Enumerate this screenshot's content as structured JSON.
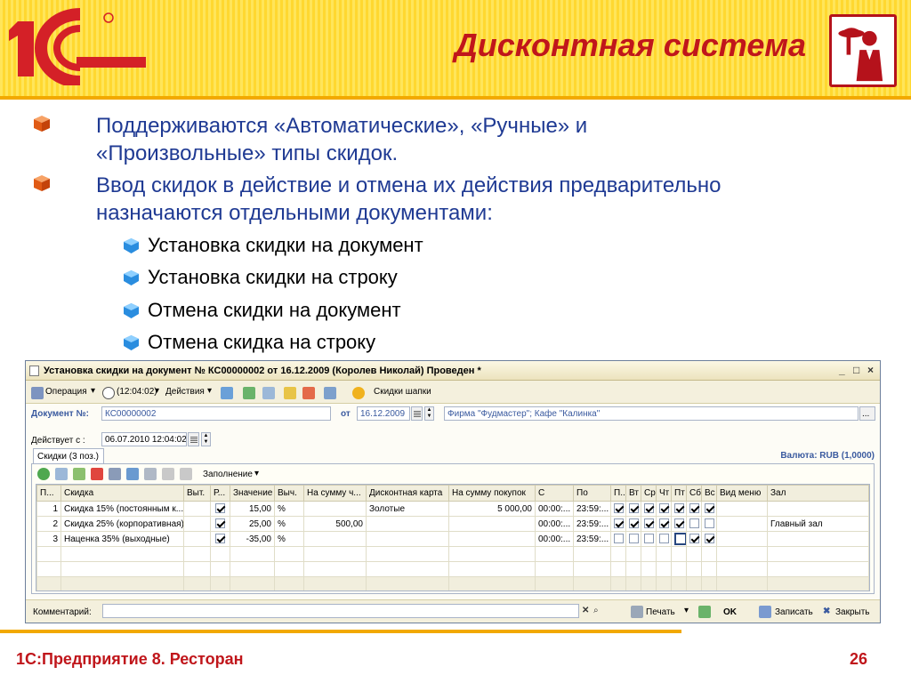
{
  "slide": {
    "title": "Дисконтная система",
    "footer_left": "1С:Предприятие 8. Ресторан",
    "page_number": "26"
  },
  "bullets": [
    {
      "line1": "Поддерживаются «Автоматические», «Ручные» и",
      "line2": "«Произвольные» типы скидок."
    },
    {
      "line1": "Ввод скидок в действие и отмена их действия предварительно",
      "line2": "назначаются отдельными документами:"
    }
  ],
  "sub_bullets": [
    "Установка скидки на документ",
    "Установка скидки на строку",
    "Отмена скидки на документ",
    "Отмена скидка на строку"
  ],
  "window": {
    "title": "Установка скидки на документ № КС00000002 от 16.12.2009 (Королев Николай) Проведен *",
    "controls": [
      "_",
      "□",
      "×"
    ],
    "toolbar": {
      "operation": "Операция",
      "time": "(12:04:02)",
      "actions": "Действия",
      "header_discounts": "Скидки шапки"
    },
    "doc_label": "Документ №:",
    "doc_number": "КС00000002",
    "date_label": "от",
    "date_value": "16.12.2009",
    "org_value": "Фирма \"Фудмастер\"; Кафе \"Калинка\"",
    "more_btn": "...",
    "valid_label": "Действует с :",
    "valid_value": "06.07.2010 12:04:02",
    "tab_label": "Скидки (3 поз.)",
    "currency": "Валюта: RUB (1,0000)",
    "fill_label": "Заполнение",
    "columns": [
      "П...",
      "Скидка",
      "Выт.",
      "Р...",
      "Значение",
      "Выч.",
      "На сумму ч...",
      "Дисконтная карта",
      "На сумму покупок",
      "С",
      "По",
      "П..",
      "Вт",
      "Ср",
      "Чт",
      "Пт",
      "Сб",
      "Вс",
      "Вид меню",
      "Зал"
    ],
    "rows": [
      {
        "n": "1",
        "name": "Скидка 15% (постоянным к...",
        "vyt": "",
        "r": true,
        "value": "15,00",
        "unit": "%",
        "sum_check": "",
        "card": "Золотые",
        "sum_buy": "5 000,00",
        "from": "00:00:...",
        "to": "23:59:...",
        "days": [
          true,
          true,
          true,
          true,
          true,
          true,
          true
        ],
        "menu": "",
        "hall": ""
      },
      {
        "n": "2",
        "name": "Скидка 25% (корпоративная)",
        "vyt": "",
        "r": true,
        "value": "25,00",
        "unit": "%",
        "sum_check": "500,00",
        "card": "",
        "sum_buy": "",
        "from": "00:00:...",
        "to": "23:59:...",
        "days": [
          true,
          true,
          true,
          true,
          true,
          false,
          false
        ],
        "menu": "",
        "hall": "Главный зал"
      },
      {
        "n": "3",
        "name": "Наценка 35% (выходные)",
        "vyt": "",
        "r": true,
        "value": "-35,00",
        "unit": "%",
        "sum_check": "",
        "card": "",
        "sum_buy": "",
        "from": "00:00:...",
        "to": "23:59:...",
        "days": [
          false,
          false,
          false,
          false,
          false,
          true,
          true
        ],
        "menu": "",
        "hall": ""
      }
    ],
    "comment_label": "Комментарий:",
    "comment_value": "",
    "print_btn": "Печать",
    "ok_btn": "OK",
    "save_btn": "Записать",
    "close_btn": "Закрыть"
  },
  "colors": {
    "accent": "#c0161b",
    "bullet_text": "#1f3a93",
    "header_bg": "#ffe14a"
  }
}
